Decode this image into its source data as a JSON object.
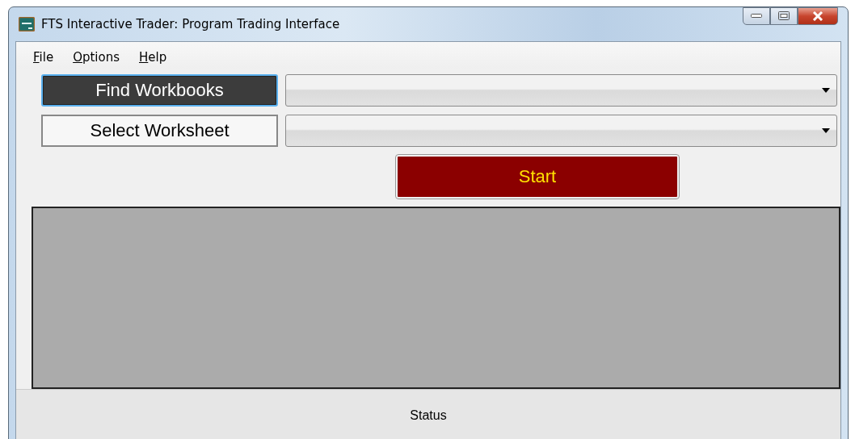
{
  "window": {
    "title": "FTS Interactive Trader: Program Trading Interface"
  },
  "menu": [
    "File",
    "Options",
    "Help"
  ],
  "rows": [
    {
      "button": {
        "label": "Find Workbooks",
        "focused": true
      }
    },
    {
      "button": {
        "label": "Select Worksheet",
        "focused": false
      }
    }
  ],
  "start_button": {
    "label": "Start"
  },
  "status_bar": "Status"
}
